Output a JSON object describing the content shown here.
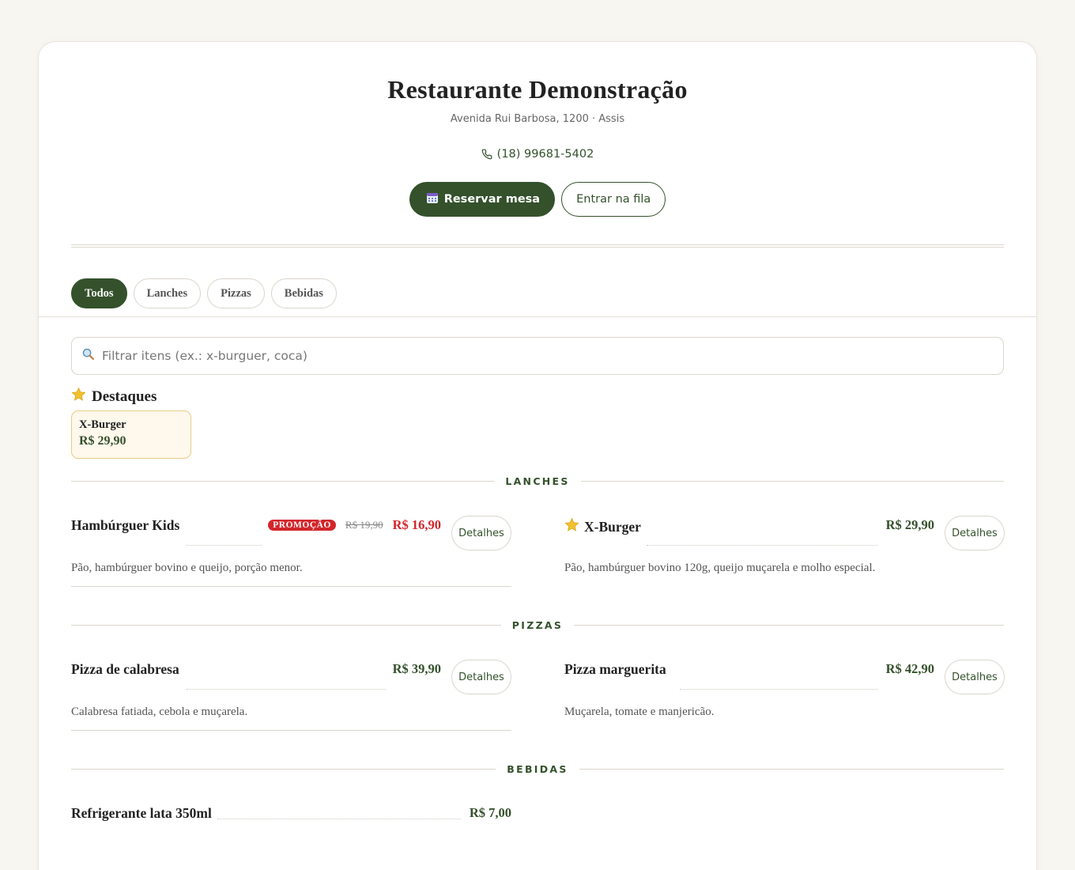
{
  "restaurant": {
    "name": "Restaurante Demonstração",
    "address": "Avenida Rui Barbosa, 1200 · Assis",
    "phone": "(18) 99681-5402"
  },
  "actions": {
    "reserve_label": "Reservar mesa",
    "queue_label": "Entrar na fila"
  },
  "tabs": [
    {
      "label": "Todos",
      "active": true
    },
    {
      "label": "Lanches",
      "active": false
    },
    {
      "label": "Pizzas",
      "active": false
    },
    {
      "label": "Bebidas",
      "active": false
    }
  ],
  "search": {
    "placeholder": "Filtrar itens (ex.: x-burguer, coca)",
    "value": ""
  },
  "featured": {
    "title": "Destaques",
    "items": [
      {
        "name": "X-Burger",
        "price": "R$ 29,90"
      }
    ]
  },
  "sections": [
    {
      "title": "LANCHES",
      "items": [
        {
          "name": "Hambúrguer Kids",
          "badge": "PROMOÇÃO",
          "old_price": "R$ 19,90",
          "price": "R$ 16,90",
          "description": "Pão, hambúrguer bovino e queijo, porção menor.",
          "details_label": "Detalhes"
        },
        {
          "name": "X-Burger",
          "featured": true,
          "price": "R$ 29,90",
          "description": "Pão, hambúrguer bovino 120g, queijo muçarela e molho especial.",
          "details_label": "Detalhes"
        }
      ]
    },
    {
      "title": "PIZZAS",
      "items": [
        {
          "name": "Pizza de calabresa",
          "price": "R$ 39,90",
          "description": "Calabresa fatiada, cebola e muçarela.",
          "details_label": "Detalhes"
        },
        {
          "name": "Pizza marguerita",
          "price": "R$ 42,90",
          "description": "Muçarela, tomate e manjericão.",
          "details_label": "Detalhes"
        }
      ]
    },
    {
      "title": "BEBIDAS",
      "items": [
        {
          "name": "Refrigerante lata 350ml",
          "price": "R$ 7,00"
        }
      ]
    }
  ],
  "colors": {
    "brand_green": "#34512c",
    "promo_red": "#d2262b",
    "featured_bg": "#fff8ec"
  }
}
